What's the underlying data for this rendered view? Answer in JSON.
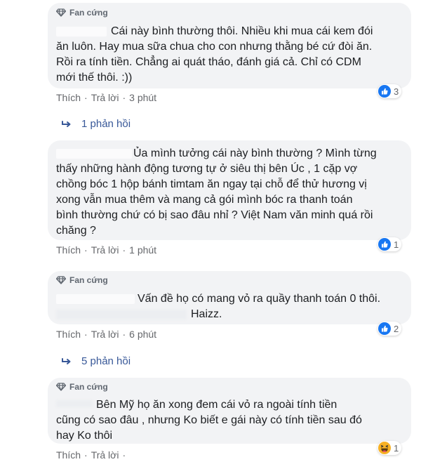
{
  "colors": {
    "link": "#385898",
    "like_blue": "#1877f2",
    "haha_yellow": "#f7b125",
    "bubble_bg": "#f2f3f5"
  },
  "comments": [
    {
      "badge": "Fan cứng",
      "lines": [
        "Cái này bình thường thôi. Nhiều khi mua cái kem đói",
        "ăn luôn. Hay mua sữa chua cho con nhưng thằng bé cứ đòi ăn.",
        "Rồi ra tính tiền. Chẳng ai quát tháo, đánh giá cả. Chỉ có CDM",
        "mới thế thôi. :))"
      ],
      "like": "Thích",
      "reply": "Trả lời",
      "time": "3 phút",
      "reaction_icon": "like-icon",
      "reaction_count": "3",
      "replies": "1 phản hồi"
    },
    {
      "badge": "",
      "lines": [
        "Ủa mình tưởng cái này bình thường ? Mình từng",
        "thấy những hành động tương tự ở siêu thị bên Úc , 1 cặp vợ",
        "chồng bóc 1 hộp bánh timtam ăn ngay tại chỗ để thử hương vị",
        "xong vẫn mua thêm và mang cả gói mình bóc ra thanh toán",
        "bình thường chứ có bị sao đâu nhỉ ? Việt Nam văn minh quá rồi",
        "chăng ?"
      ],
      "like": "Thích",
      "reply": "Trả lời",
      "time": "1 phút",
      "reaction_icon": "like-icon",
      "reaction_count": "1",
      "replies": ""
    },
    {
      "badge": "Fan cứng",
      "lines": [
        "Vấn đề họ có mang vỏ ra quầy thanh toán 0 thôi.",
        "Haizz."
      ],
      "like": "Thích",
      "reply": "Trả lời",
      "time": "6 phút",
      "reaction_icon": "like-icon",
      "reaction_count": "2",
      "replies": "5 phản hồi"
    },
    {
      "badge": "Fan cứng",
      "lines": [
        "Bên Mỹ họ ăn xong đem cái vỏ ra ngoài tính tiền",
        "cũng có sao đâu , nhưng Ko biết e gái này có tính tiền sau đó",
        "hay Ko thôi"
      ],
      "like": "Thích",
      "reply": "Trả lời",
      "time": "",
      "reaction_icon": "haha-icon",
      "reaction_count": "1",
      "replies": ""
    }
  ],
  "separator": "·"
}
